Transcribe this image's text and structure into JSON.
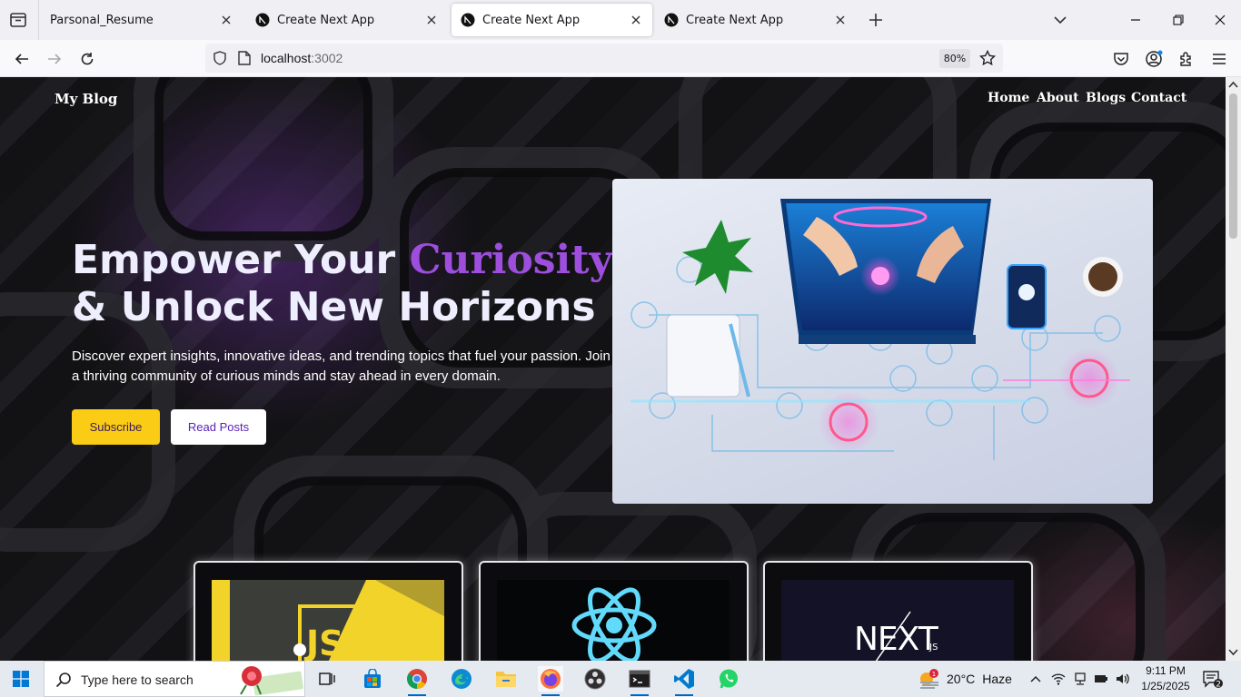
{
  "browser": {
    "tabs": [
      {
        "title": "Parsonal_Resume",
        "active": false
      },
      {
        "title": "Create Next App",
        "active": false
      },
      {
        "title": "Create Next App",
        "active": true
      },
      {
        "title": "Create Next App",
        "active": false
      }
    ],
    "url": {
      "host": "localhost",
      "port": ":3002"
    },
    "zoom": "80%"
  },
  "site": {
    "logo": "My Blog",
    "nav": [
      "Home",
      "About",
      "Blogs",
      "Contact"
    ],
    "hero": {
      "title_part1": "Empower Your ",
      "title_accent": "Curiosity",
      "title_part2": "& Unlock New Horizons",
      "description": "Discover expert insights, innovative ideas, and trending topics that fuel your passion. Join a thriving community of curious minds and stay ahead in every domain.",
      "subscribe_label": "Subscribe",
      "read_label": "Read Posts"
    },
    "cards": [
      {
        "icon": "javascript-logo",
        "text": "JS"
      },
      {
        "icon": "react-logo"
      },
      {
        "icon": "nextjs-logo",
        "text": "NEXT",
        "sub": ".JS"
      }
    ],
    "colors": {
      "accent": "#9d4edd",
      "subscribe": "#facc15"
    }
  },
  "taskbar": {
    "search_placeholder": "Type here to search",
    "weather": {
      "temp": "20°C",
      "condition": "Haze",
      "badge": "1"
    },
    "time": "9:11 PM",
    "date": "1/25/2025",
    "notifications": "2"
  }
}
